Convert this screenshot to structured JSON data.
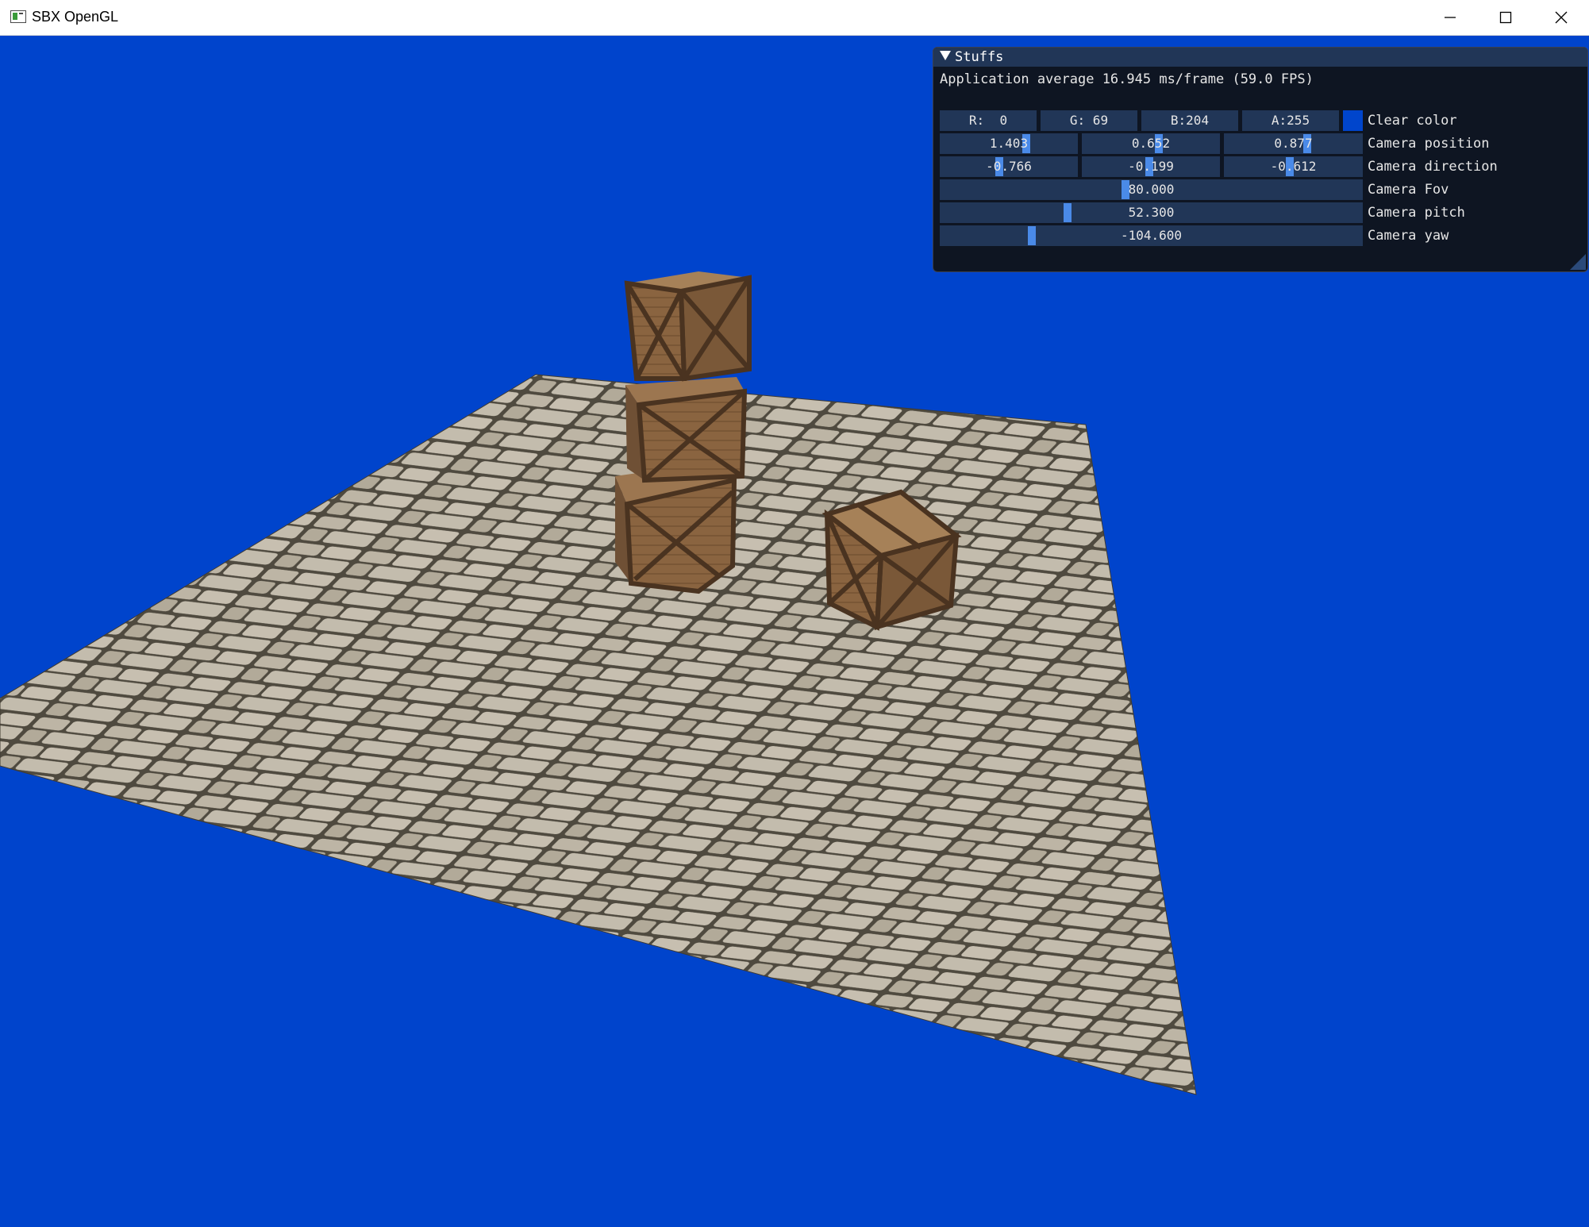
{
  "window": {
    "title": "SBX OpenGL",
    "controls": [
      "minimize-icon",
      "maximize-icon",
      "close-icon"
    ]
  },
  "colors": {
    "clear_color": "#0044cc",
    "panel_bg": "#0e1522",
    "widget_bg": "#213657",
    "slider_grab": "#4a8ae8"
  },
  "panel": {
    "title": "Stuffs",
    "fps_line": "Application average 16.945 ms/frame (59.0 FPS)",
    "clear_color": {
      "label": "Clear color",
      "r": "R:  0",
      "g": "G: 69",
      "b": "B:204",
      "a": "A:255"
    },
    "camera_position": {
      "label": "Camera position",
      "values": [
        "1.403",
        "0.652",
        "0.877"
      ]
    },
    "camera_direction": {
      "label": "Camera direction",
      "values": [
        "-0.766",
        "-0.199",
        "-0.612"
      ]
    },
    "camera_fov": {
      "label": "Camera Fov",
      "value": "80.000"
    },
    "camera_pitch": {
      "label": "Camera pitch",
      "value": "52.300"
    },
    "camera_yaw": {
      "label": "Camera yaw",
      "value": "-104.600"
    }
  },
  "scene": {
    "floor_texture": "cobblestone",
    "objects": [
      "crate",
      "crate",
      "crate",
      "crate"
    ]
  }
}
